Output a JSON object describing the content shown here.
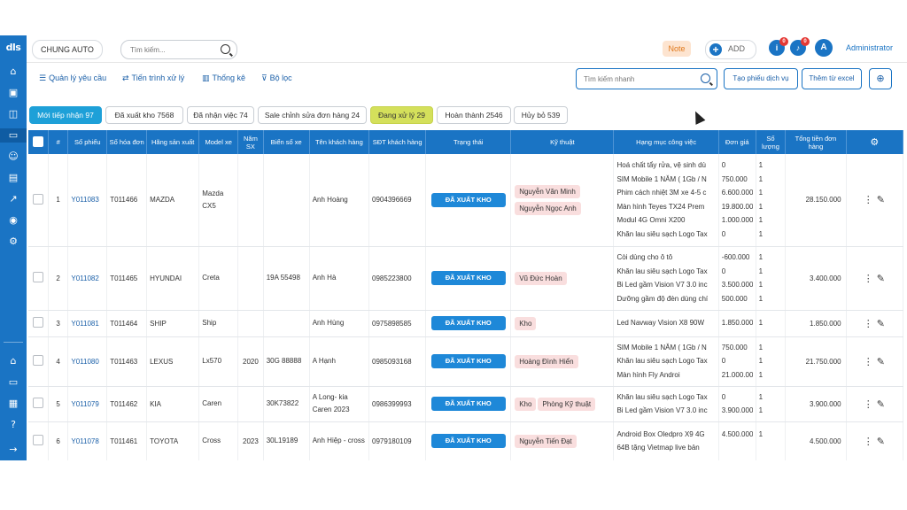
{
  "sidebar": {
    "logo": "dls",
    "icons": [
      "tag-icon",
      "box-icon",
      "package-icon",
      "monitor-icon",
      "users-icon",
      "receipt-icon",
      "chart-icon",
      "cash-icon",
      "settings-icon"
    ],
    "bottom_icons": [
      "home-icon",
      "card-icon",
      "calculator-icon",
      "help-icon",
      "arrow-right-icon"
    ]
  },
  "topbar": {
    "company": "CHUNG AUTO",
    "search_placeholder": "Tìm kiếm...",
    "note_label": "Note",
    "add_label": "ADD",
    "badge1": "0",
    "badge2": "0",
    "avatar": "A",
    "user": "Administrator"
  },
  "toolbar": {
    "menu": [
      "Quản lý yêu cầu",
      "Tiến trình xử lý",
      "Thống kê",
      "Bộ lọc"
    ],
    "search_placeholder": "Tìm kiếm nhanh",
    "create_label": "Tạo phiếu dịch vụ",
    "import_label": "Thêm từ excel"
  },
  "status_tabs": [
    "Mới tiếp nhận 97",
    "Đã xuất kho 7568",
    "Đã nhận việc 74",
    "Sale chỉnh sửa đơn hàng 24",
    "Đang xử lý 29",
    "Hoàn thành 2546",
    "Hủy bỏ 539"
  ],
  "table": {
    "headers": [
      "#",
      "Số phiếu",
      "Số hóa đơn",
      "Hãng sản xuất",
      "Model xe",
      "Năm SX",
      "Biển số xe",
      "Tên khách hàng",
      "SĐT khách hàng",
      "Trạng thái",
      "Kỹ thuật",
      "Hạng mục công việc",
      "Đơn giá",
      "Số lượng",
      "Tổng tiền đơn hàng"
    ],
    "rows": [
      {
        "num": "1",
        "ticket": "Y011083",
        "invoice": "T011466",
        "brand": "MAZDA",
        "model": "Mazda CX5",
        "year": "",
        "plate": "",
        "customer": "Anh Hoàng",
        "phone": "0904396669",
        "status": "ĐÃ XUẤT KHO",
        "techs": [
          "Nguyễn Văn Minh",
          "Nguyễn Ngọc Anh"
        ],
        "items": [
          "Hoá chất tẩy rửa, vệ sinh dù",
          "SIM Mobile 1 NĂM ( 1Gb / N",
          "Phim cách nhiệt 3M xe 4-5 c",
          "Màn hình Teyes TX24 Prem",
          "Modul 4G Omni X200",
          "Khăn lau siêu sạch Logo Tax"
        ],
        "prices": [
          "0",
          "750.000",
          "6.600.000",
          "19.800.000",
          "1.000.000",
          "0"
        ],
        "qtys": [
          "1",
          "1",
          "1",
          "1",
          "1",
          "1"
        ],
        "total": "28.150.000"
      },
      {
        "num": "2",
        "ticket": "Y011082",
        "invoice": "T011465",
        "brand": "HYUNDAI",
        "model": "Creta",
        "year": "",
        "plate": "19A 55498",
        "customer": "Anh Hà",
        "phone": "0985223800",
        "status": "ĐÃ XUẤT KHO",
        "techs": [
          "Vũ Đức Hoàn"
        ],
        "items": [
          "Còi dùng cho ô tô",
          "Khăn lau siêu sạch Logo Tax",
          "Bi Led gầm Vision V7 3.0 inc",
          "Dưỡng gầm độ đèn dùng chí"
        ],
        "prices": [
          "-600.000",
          "0",
          "3.500.000",
          "500.000"
        ],
        "qtys": [
          "1",
          "1",
          "1",
          "1"
        ],
        "total": "3.400.000"
      },
      {
        "num": "3",
        "ticket": "Y011081",
        "invoice": "T011464",
        "brand": "SHIP",
        "model": "Ship",
        "year": "",
        "plate": "",
        "customer": "Anh Hùng",
        "phone": "0975898585",
        "status": "ĐÃ XUẤT KHO",
        "techs": [
          "Kho"
        ],
        "items": [
          "Led Navway Vision X8 90W"
        ],
        "prices": [
          "1.850.000"
        ],
        "qtys": [
          "1"
        ],
        "total": "1.850.000"
      },
      {
        "num": "4",
        "ticket": "Y011080",
        "invoice": "T011463",
        "brand": "LEXUS",
        "model": "Lx570",
        "year": "2020",
        "plate": "30G 88888",
        "customer": "A Hạnh",
        "phone": "0985093168",
        "status": "ĐÃ XUẤT KHO",
        "techs": [
          "Hoàng Đình Hiển"
        ],
        "items": [
          "SIM Mobile 1 NĂM ( 1Gb / N",
          "Khăn lau siêu sạch Logo Tax",
          "Màn hình Fly Androi"
        ],
        "prices": [
          "750.000",
          "0",
          "21.000.000"
        ],
        "qtys": [
          "1",
          "1",
          "1"
        ],
        "total": "21.750.000"
      },
      {
        "num": "5",
        "ticket": "Y011079",
        "invoice": "T011462",
        "brand": "KIA",
        "model": "Caren",
        "year": "",
        "plate": "30K73822",
        "customer": "A Long- kia Caren 2023",
        "phone": "0986399993",
        "status": "ĐÃ XUẤT KHO",
        "techs": [
          "Kho",
          "Phòng Kỹ thuật"
        ],
        "items": [
          "Khăn lau siêu sạch Logo Tax",
          "Bi Led gầm Vision V7 3.0 inc"
        ],
        "prices": [
          "0",
          "3.900.000"
        ],
        "qtys": [
          "1",
          "1"
        ],
        "total": "3.900.000"
      },
      {
        "num": "6",
        "ticket": "Y011078",
        "invoice": "T011461",
        "brand": "TOYOTA",
        "model": "Cross",
        "year": "2023",
        "plate": "30L19189",
        "customer": "Anh Hiệp - cross",
        "phone": "0979180109",
        "status": "ĐÃ XUẤT KHO",
        "techs": [
          "Nguyễn Tiến Đạt"
        ],
        "items": [
          "Android Box Oledpro X9 4G",
          "64B tặng Vietmap live bản"
        ],
        "prices": [
          "4.500.000",
          ""
        ],
        "qtys": [
          "1",
          ""
        ],
        "total": "4.500.000"
      }
    ]
  },
  "colors": {
    "primary": "#1a74c4",
    "status": "#1e88d8",
    "tab_active": "#1ea0d8",
    "tab_processing": "#d4e05b",
    "chip": "#f9dede"
  }
}
